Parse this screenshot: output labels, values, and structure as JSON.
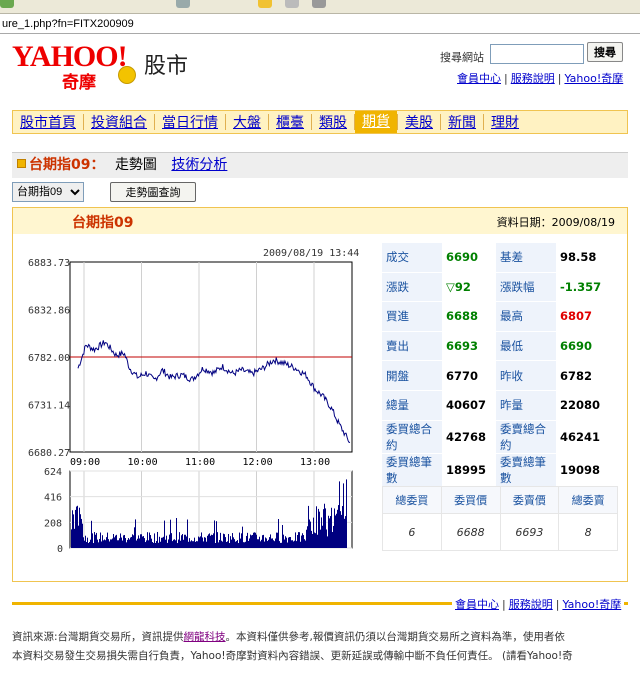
{
  "address": "ure_1.php?fn=FITX200909",
  "search": {
    "label": "搜尋網站",
    "button": "搜尋"
  },
  "top_links": [
    "會員中心",
    "服務說明",
    "Yahoo!奇摩"
  ],
  "logo": {
    "brand": "YAHOO!",
    "sub": "奇摩",
    "product": "股市"
  },
  "nav": [
    {
      "label": "股市首頁",
      "active": false
    },
    {
      "label": "投資組合",
      "active": false
    },
    {
      "label": "當日行情",
      "active": false
    },
    {
      "label": "大盤",
      "active": false
    },
    {
      "label": "櫃臺",
      "active": false
    },
    {
      "label": "類股",
      "active": false
    },
    {
      "label": "期貨",
      "active": true
    },
    {
      "label": "美股",
      "active": false
    },
    {
      "label": "新聞",
      "active": false
    },
    {
      "label": "理財",
      "active": false
    }
  ],
  "title": {
    "name": "台期指09",
    "colon": "：",
    "current": "走勢圖",
    "link": "技術分析"
  },
  "controls": {
    "select_value": "台期指09",
    "query_button": "走勢圖查詢"
  },
  "box": {
    "name": "台期指09",
    "date_label": "資料日期：",
    "date": "2009/08/19"
  },
  "chart_data": {
    "type": "line",
    "timestamp": "2009/08/19 13:44",
    "price": {
      "yticks": [
        6883.73,
        6832.86,
        6782.0,
        6731.14,
        6680.27
      ],
      "ylim": [
        6680.27,
        6883.73
      ],
      "reference": 6782.0,
      "xticks": [
        "09:00",
        "10:00",
        "11:00",
        "12:00",
        "13:00"
      ]
    },
    "volume": {
      "yticks": [
        624,
        416,
        208,
        0
      ],
      "ylim": [
        0,
        624
      ]
    }
  },
  "stats": [
    {
      "l1": "成交",
      "v1": "6690",
      "c1": "#008000",
      "l2": "基差",
      "v2": "98.58",
      "c2": "#000000"
    },
    {
      "l1": "漲跌",
      "v1": "▽92",
      "c1": "#008000",
      "l2": "漲跌幅",
      "v2": "-1.357",
      "c2": "#008000"
    },
    {
      "l1": "買進",
      "v1": "6688",
      "c1": "#008000",
      "l2": "最高",
      "v2": "6807",
      "c2": "#e00000"
    },
    {
      "l1": "賣出",
      "v1": "6693",
      "c1": "#008000",
      "l2": "最低",
      "v2": "6690",
      "c2": "#008000"
    },
    {
      "l1": "開盤",
      "v1": "6770",
      "c1": "#000000",
      "l2": "昨收",
      "v2": "6782",
      "c2": "#000000"
    },
    {
      "l1": "總量",
      "v1": "40607",
      "c1": "#000000",
      "l2": "昨量",
      "v2": "22080",
      "c2": "#000000"
    },
    {
      "l1": "委買總合約",
      "v1": "42768",
      "c1": "#000000",
      "l2": "委賣總合約",
      "v2": "46241",
      "c2": "#000000"
    },
    {
      "l1": "委買總筆數",
      "v1": "18995",
      "c1": "#000000",
      "l2": "委賣總筆數",
      "v2": "19098",
      "c2": "#000000"
    }
  ],
  "book": {
    "headers": [
      "總委買",
      "委買價",
      "委賣價",
      "總委賣"
    ],
    "values": [
      "6",
      "6688",
      "6693",
      "8"
    ]
  },
  "footer": {
    "links": [
      "會員中心",
      "服務說明",
      "Yahoo!奇摩"
    ],
    "disclaimer1_pre": "資訊來源:台灣期貨交易所，資訊提供",
    "disclaimer1_link": "網龍科技",
    "disclaimer1_post": "。本資料僅供參考,報價資訊仍須以台灣期貨交易所之資料為準，使用者依",
    "disclaimer2": "本資料交易發生交易損失需自行負責，Yahoo!奇摩對資料內容錯誤、更新延誤或傳輸中斷不負任何責任。 (請看Yahoo!奇"
  },
  "colors": {
    "accent": "#f0b400",
    "title_red": "#cc3300",
    "ref_line": "#c00000",
    "series": "#000080"
  }
}
